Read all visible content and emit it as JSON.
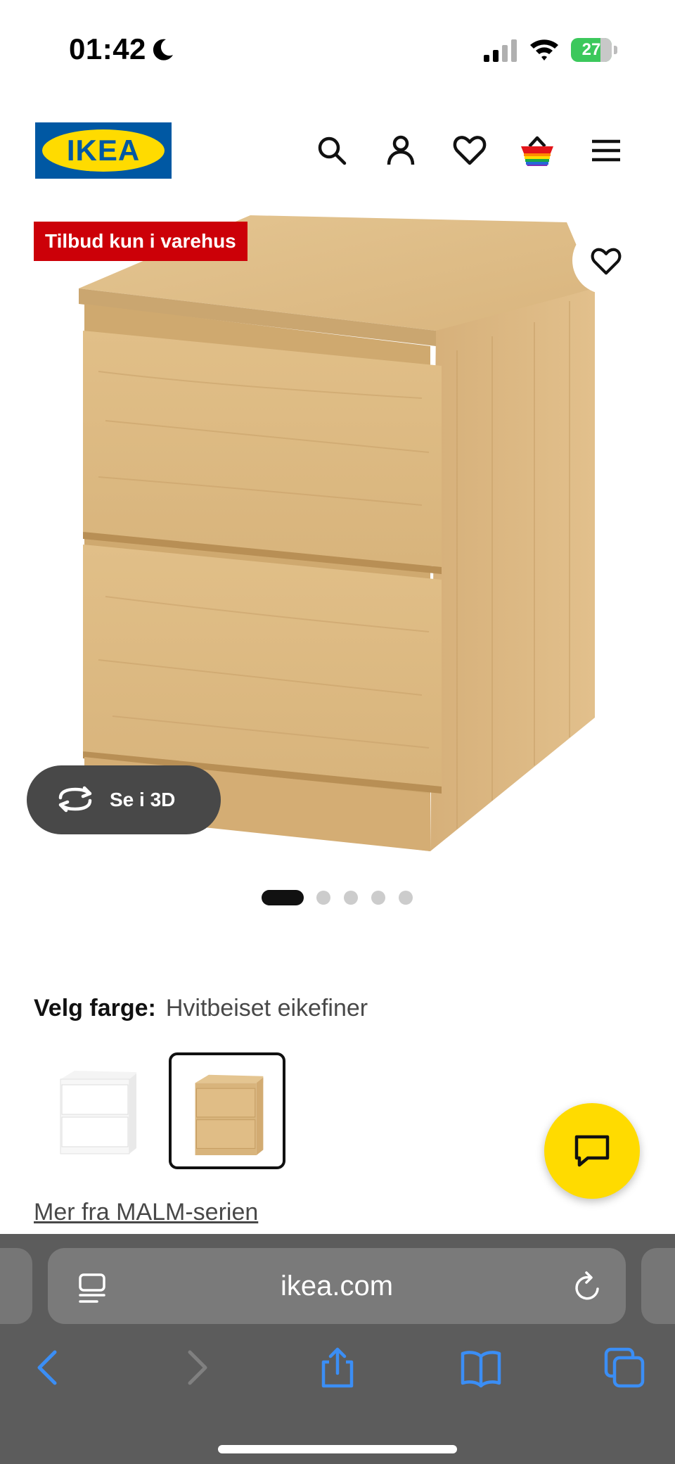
{
  "status_bar": {
    "time": "01:42",
    "battery": "27"
  },
  "header": {
    "logo_text": "IKEA",
    "icons": [
      "search-icon",
      "account-icon",
      "favourites-icon",
      "basket-icon",
      "menu-icon"
    ]
  },
  "product": {
    "badge": "Tilbud kun i varehus",
    "view_3d_label": "Se i 3D",
    "image_count": 5,
    "active_image": 1,
    "color_heading": "Velg farge:",
    "color_value": "Hvitbeiset eikefiner",
    "swatches": [
      {
        "name": "white",
        "selected": false
      },
      {
        "name": "white-stained-oak-veneer",
        "selected": true
      }
    ],
    "series_link": "Mer fra MALM-serien"
  },
  "browser": {
    "url": "ikea.com"
  },
  "colors": {
    "ikea_blue": "#0058a3",
    "ikea_yellow": "#ffdb00",
    "badge_red": "#cc0008",
    "browser_bar": "#5c5c5c",
    "safari_blue": "#3b8ef5",
    "battery_green": "#3cc85c"
  }
}
